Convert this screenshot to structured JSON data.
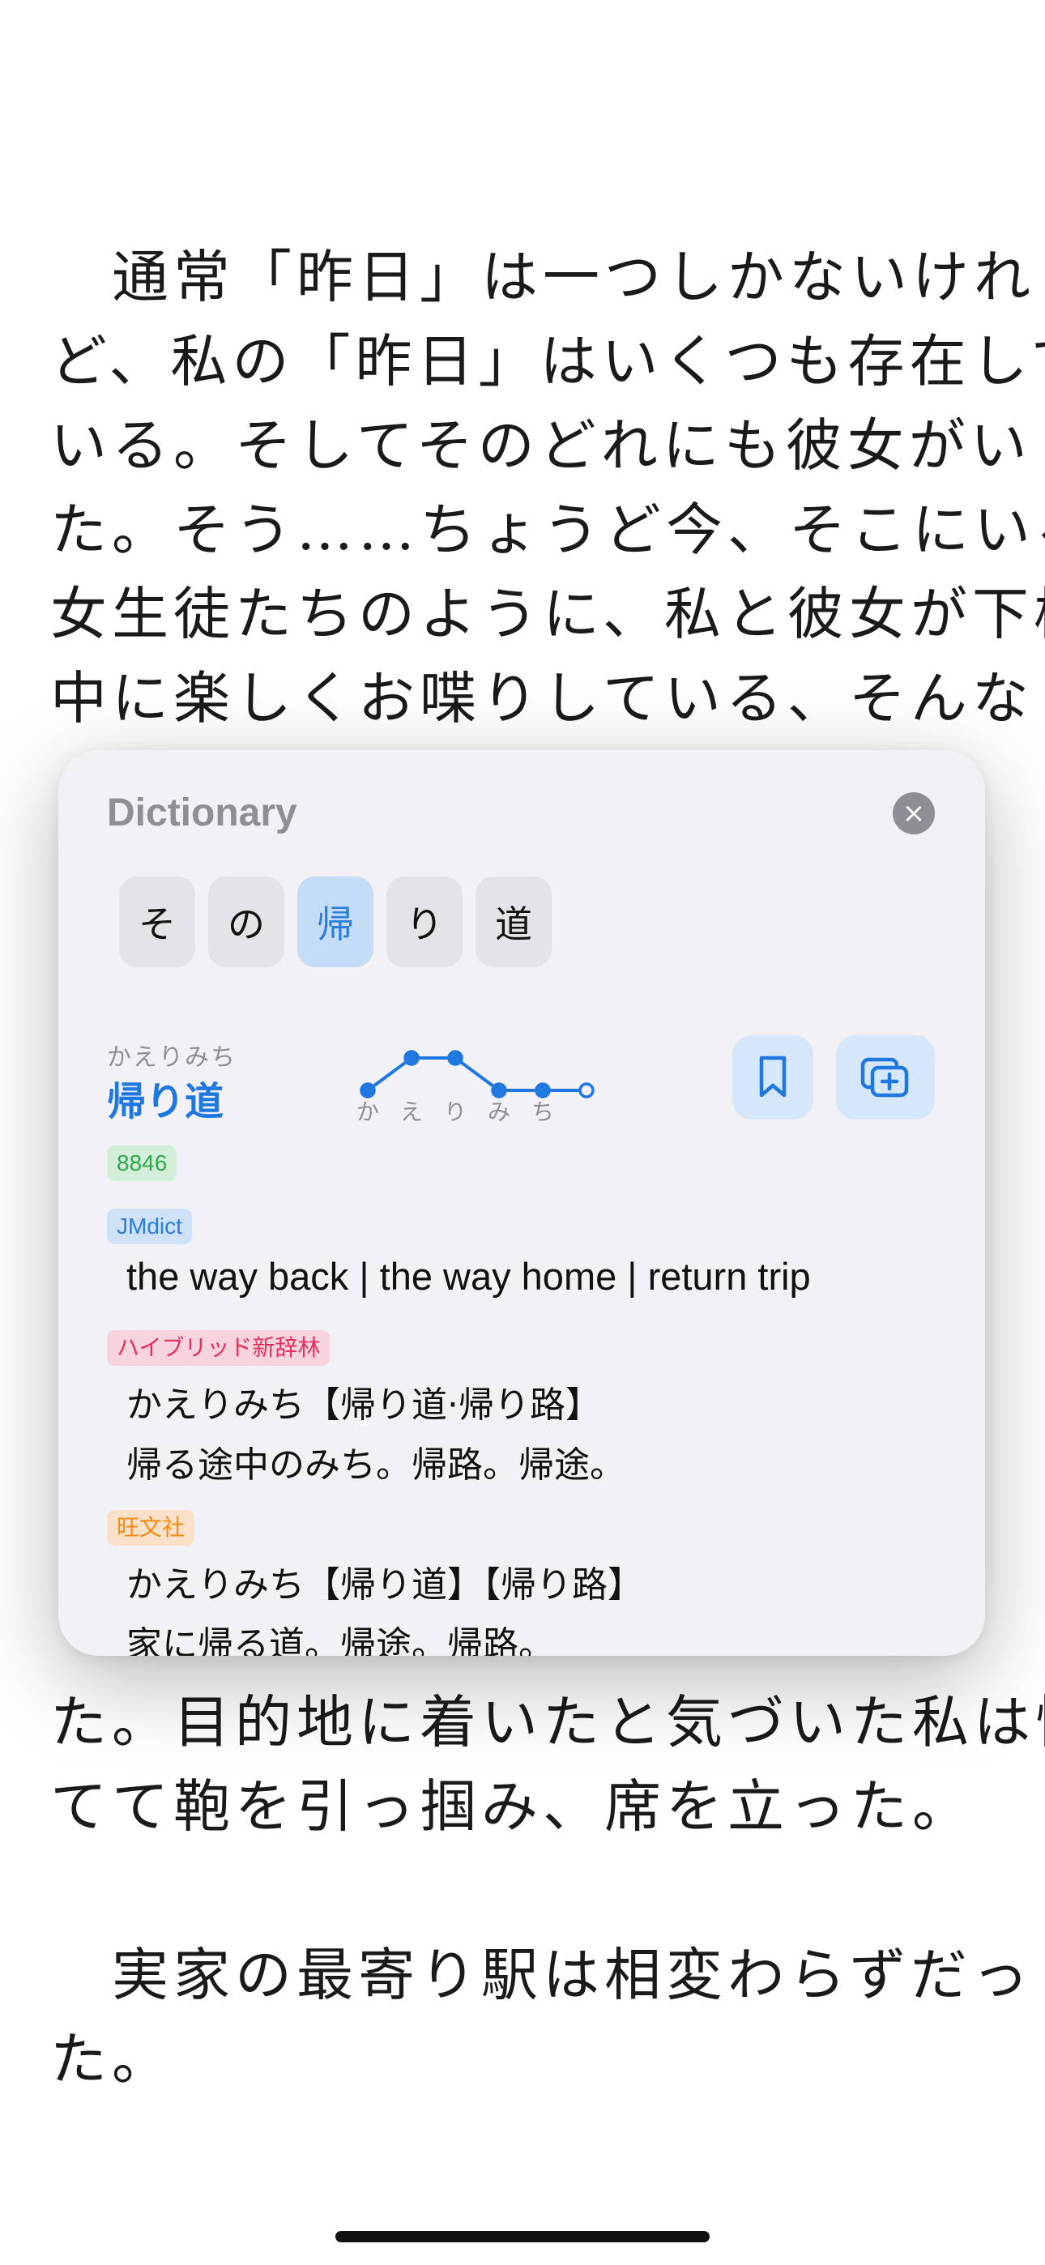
{
  "reader": {
    "lines": [
      "　通常「昨日」は一つしかないけれ",
      "ど、私の「昨日」はいくつも存在して",
      "いる。そしてそのどれにも彼女がい",
      "た。そう……ちょうど今、そこにいる",
      "女生徒たちのように、私と彼女が下校",
      "中に楽しくお喋りしている、そんな"
    ],
    "lines_after": [
      "た。目的地に着いたと気づいた私は慌",
      "てて鞄を引っ掴み、席を立った。",
      "",
      "　実家の最寄り駅は相変わらずだっ",
      "た。"
    ]
  },
  "popup": {
    "title": "Dictionary",
    "close_icon": "×",
    "tokens": [
      "そ",
      "の",
      "帰",
      "り",
      "道"
    ],
    "selected_token_index": 2,
    "entry": {
      "reading": "かえりみち",
      "headword": "帰り道",
      "pitch_morae": [
        "か",
        "え",
        "り",
        "み",
        "ち"
      ],
      "pitch_pattern": [
        0,
        1,
        1,
        0,
        0,
        0
      ],
      "frequency": "8846"
    },
    "dictionaries": [
      {
        "name": "JMdict",
        "color": "#2a7ed9",
        "lines": [
          "the way back | the way home | return trip"
        ]
      },
      {
        "name": "ハイブリッド新辞林",
        "color": "#e0305e",
        "lines": [
          "かえりみち【帰り道·帰り路】",
          "帰る途中のみち。帰路。帰途。"
        ]
      },
      {
        "name": "旺文社",
        "color": "#f08c16",
        "lines": [
          "かえりみち【帰り道】【帰り路】",
          "家に帰る道。帰途。帰路。"
        ]
      }
    ]
  }
}
